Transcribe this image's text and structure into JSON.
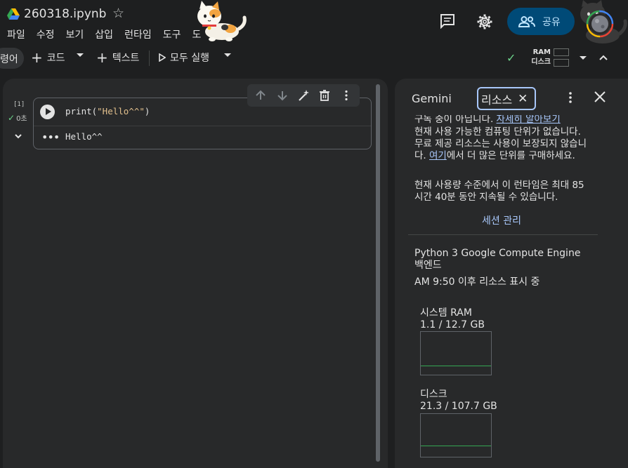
{
  "header": {
    "title": "260318.ipynb",
    "menu": [
      "파일",
      "수정",
      "보기",
      "삽입",
      "런타임",
      "도구",
      "도"
    ],
    "share_label": "공유"
  },
  "toolbar": {
    "left_pill_label": "령어",
    "code_label": "코드",
    "text_label": "텍스트",
    "run_all_label": "모두 실행",
    "ram_label": "RAM",
    "disk_label": "디스크"
  },
  "cell": {
    "exec_count": "[1]",
    "exec_time": "0초",
    "code_prefix": "print(",
    "code_string": "\"Hello^^\"",
    "code_suffix": ")",
    "output": "Hello^^"
  },
  "panel": {
    "tab_gemini": "Gemini",
    "tab_resources": "리소스",
    "cut_line_prefix": "구독 중이 아닙니다.",
    "cut_line_link": "자세히 알아보기",
    "notice_line1": "현재 사용 가능한 컴퓨팅 단위가 없습니다. 무료 제공 리소스는 사용이 보장되지 않습니다.",
    "notice_link": "여기",
    "notice_line2": "에서 더 많은 단위를 구매하세요.",
    "usage_text": "현재 사용량 수준에서 이 런타임은 최대 85시간 40분 동안 지속될 수 있습니다.",
    "session_manage": "세션 관리",
    "backend": "Python 3 Google Compute Engine 백엔드",
    "since": "AM 9:50 이후 리소스 표시 중",
    "ram_title": "시스템 RAM",
    "ram_value": "1.1 / 12.7 GB",
    "ram_fraction": 0.087,
    "disk_title": "디스크",
    "disk_value": "21.3 / 107.7 GB",
    "disk_fraction": 0.198
  },
  "colors": {
    "background": "#1e1f20",
    "pane": "#28292a",
    "accent_blue": "#a8c7fa",
    "share_bg": "#004a77",
    "graph_line": "#34a853",
    "check_green": "#6dd58c"
  }
}
